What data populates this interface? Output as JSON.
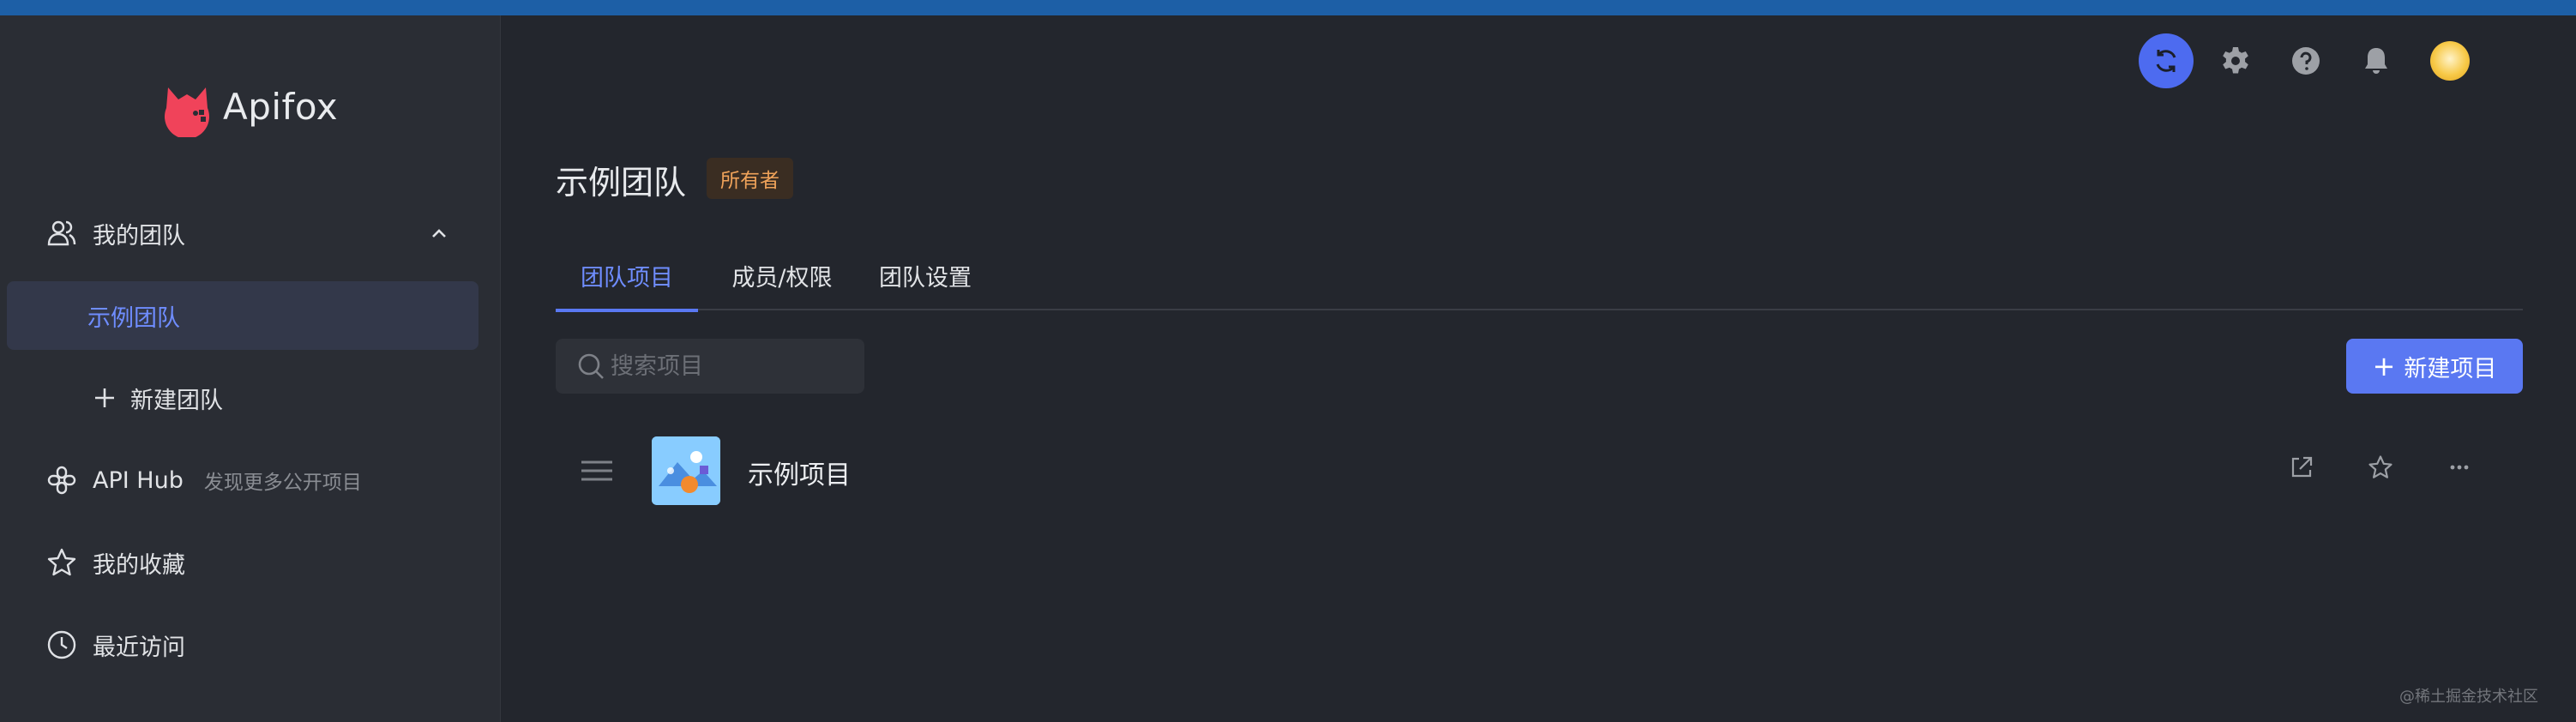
{
  "app": {
    "name": "Apifox"
  },
  "sidebar": {
    "my_team": "我的团队",
    "active_team": "示例团队",
    "new_team": "新建团队",
    "api_hub": "API Hub",
    "api_hub_sub": "发现更多公开项目",
    "favorites": "我的收藏",
    "recent": "最近访问"
  },
  "header": {
    "team_title": "示例团队",
    "owner_badge": "所有者"
  },
  "tabs": [
    {
      "label": "团队项目"
    },
    {
      "label": "成员/权限"
    },
    {
      "label": "团队设置"
    }
  ],
  "toolbar": {
    "search_placeholder": "搜索项目",
    "new_project": "新建项目"
  },
  "projects": [
    {
      "name": "示例项目"
    }
  ],
  "watermark": "@稀土掘金技术社区",
  "colors": {
    "accent": "#5a78f2",
    "active_text": "#6f8dff",
    "badge_text": "#f0a35a",
    "background": "#23262d",
    "sidebar": "#2a2d34"
  },
  "icons": [
    "sync-icon",
    "gear-icon",
    "help-icon",
    "bell-icon",
    "avatar",
    "users-icon",
    "chevron-up-icon",
    "plus-icon",
    "api-hub-icon",
    "star-icon",
    "clock-icon",
    "search-icon",
    "drag-handle-icon",
    "open-external-icon",
    "more-icon"
  ]
}
